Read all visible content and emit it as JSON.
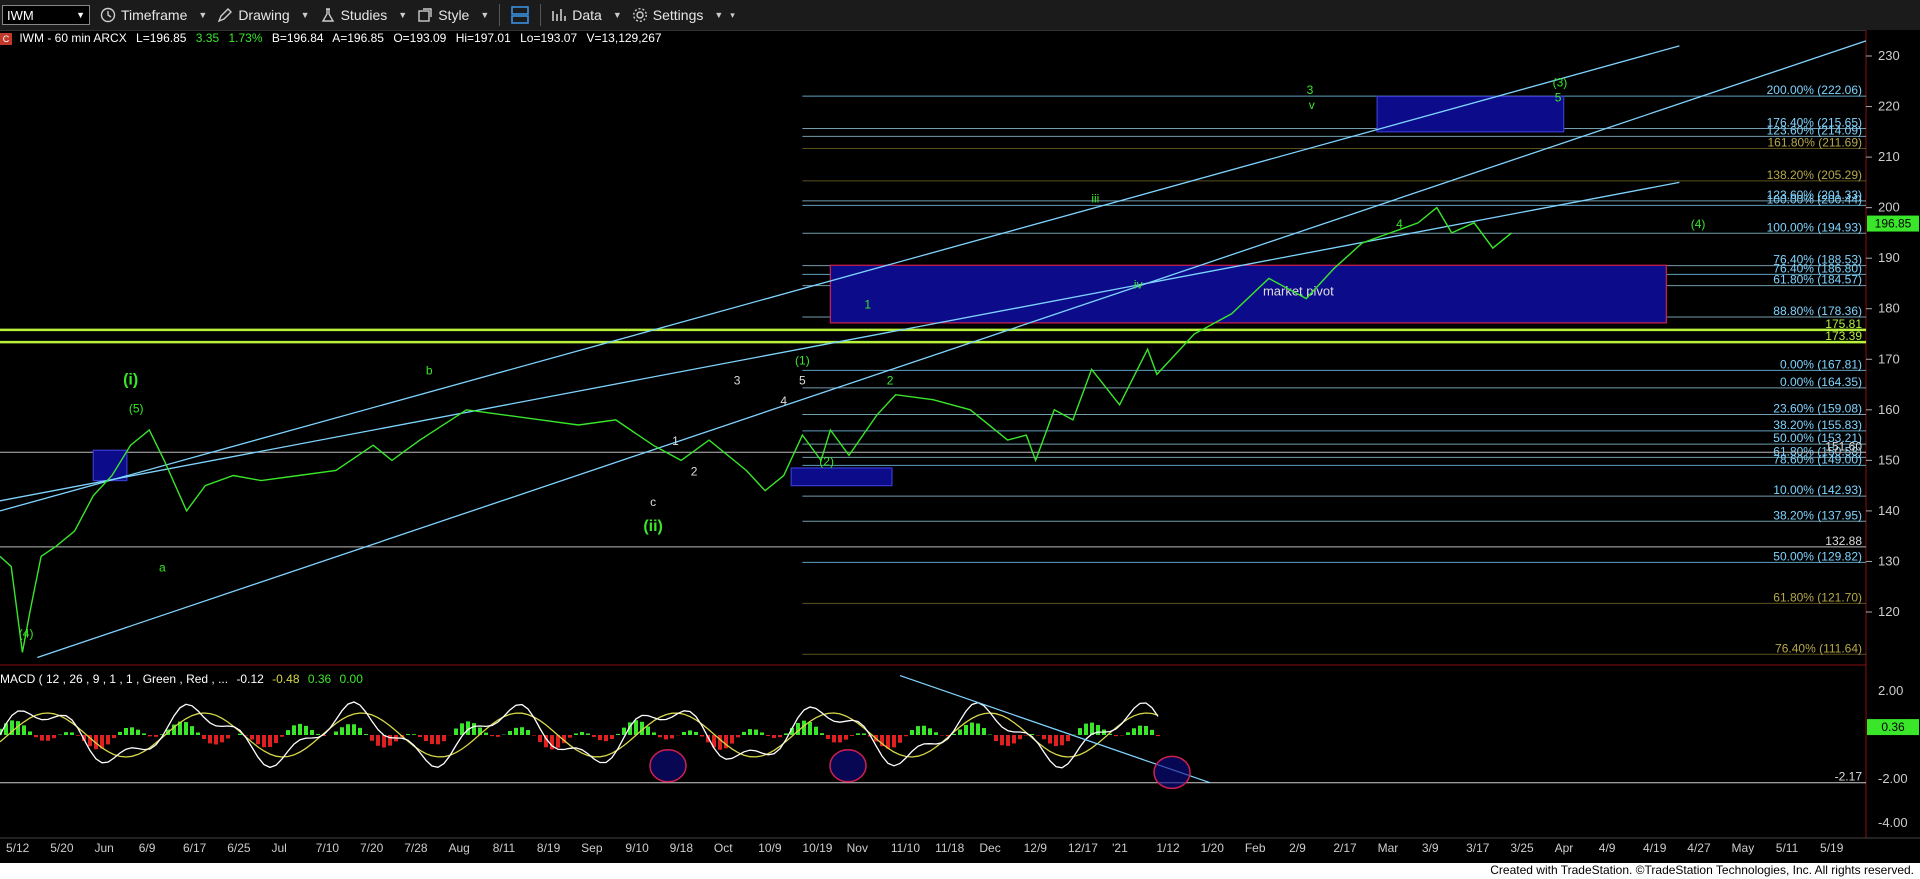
{
  "toolbar": {
    "symbol": "IWM",
    "timeframe": "Timeframe",
    "drawing": "Drawing",
    "studies": "Studies",
    "style": "Style",
    "data": "Data",
    "settings": "Settings"
  },
  "status": {
    "c_badge": "C",
    "symbol_line": "IWM - 60 min  ARCX",
    "last": "L=196.85",
    "change": "3.35",
    "pct": "1.73%",
    "bid": "B=196.84",
    "ask": "A=196.85",
    "open": "O=193.09",
    "high": "Hi=197.01",
    "low": "Lo=193.07",
    "volume": "V=13,129,267"
  },
  "macd_header": {
    "label": "MACD ( 12 , 26 , 9 , 1 , 1 , Green , Red , ...",
    "v1": "-0.12",
    "v2": "-0.48",
    "v3": "0.36",
    "v4": "0.00"
  },
  "footer": "Created with TradeStation. ©TradeStation Technologies, Inc. All rights reserved.",
  "colors": {
    "price": "#39e62a",
    "fib": "#7fd4ff",
    "box": "#0c0c8a",
    "pivot": "#b8f23a",
    "macd_line": "#ffffff",
    "signal_line": "#d7d74a"
  },
  "chart_data": {
    "type": "line",
    "title": "IWM - 60 min",
    "yrange": [
      110,
      234
    ],
    "last_price": "196.85",
    "x_ticks": [
      "5/12",
      "5/20",
      "Jun",
      "6/9",
      "6/17",
      "6/25",
      "Jul",
      "7/10",
      "7/20",
      "7/28",
      "Aug",
      "8/11",
      "8/19",
      "Sep",
      "9/10",
      "9/18",
      "Oct",
      "10/9",
      "10/19",
      "Nov",
      "11/10",
      "11/18",
      "Dec",
      "12/9",
      "12/17",
      "'21",
      "1/12",
      "1/20",
      "Feb",
      "2/9",
      "2/17",
      "Mar",
      "3/9",
      "3/17",
      "3/25",
      "Apr",
      "4/9",
      "4/19",
      "4/27",
      "May",
      "5/11",
      "5/19"
    ],
    "y_ticks": [
      "230",
      "220",
      "210",
      "200",
      "190",
      "180",
      "170",
      "160",
      "150",
      "140",
      "130",
      "120"
    ],
    "price_series": {
      "name": "IWM",
      "x": [
        0,
        0.006,
        0.012,
        0.016,
        0.022,
        0.03,
        0.04,
        0.05,
        0.06,
        0.07,
        0.08,
        0.088,
        0.1,
        0.11,
        0.125,
        0.14,
        0.16,
        0.18,
        0.2,
        0.21,
        0.225,
        0.25,
        0.27,
        0.29,
        0.31,
        0.33,
        0.35,
        0.365,
        0.38,
        0.4,
        0.41,
        0.42,
        0.43,
        0.44,
        0.445,
        0.455,
        0.47,
        0.48,
        0.5,
        0.52,
        0.54,
        0.55,
        0.555,
        0.565,
        0.575,
        0.585,
        0.6,
        0.615,
        0.62,
        0.64,
        0.66,
        0.68,
        0.7,
        0.715,
        0.73,
        0.745,
        0.76,
        0.77,
        0.778,
        0.79,
        0.8,
        0.81
      ],
      "y": [
        131,
        129,
        112,
        120,
        131,
        133,
        136,
        143,
        147,
        153,
        156,
        150,
        140,
        145,
        147,
        146,
        147,
        148,
        153,
        150,
        154,
        160,
        159,
        158,
        157,
        158,
        153,
        150,
        154,
        148,
        144,
        147,
        155,
        150,
        156,
        151,
        159,
        163,
        162,
        160,
        154,
        155,
        150,
        160,
        158,
        168,
        161,
        172,
        167,
        175,
        179,
        186,
        182,
        188,
        193,
        195,
        197,
        200,
        195,
        197,
        192,
        195
      ]
    },
    "fib_levels": [
      {
        "label": "200.00% (222.06)",
        "y": 222.06
      },
      {
        "label": "176.40% (215.65)",
        "y": 215.65
      },
      {
        "label": "123.60% (214.09)",
        "y": 214.09
      },
      {
        "label": "161.80% (211.69)",
        "y": 211.69
      },
      {
        "label": "138.20% (205.29)",
        "y": 205.29
      },
      {
        "label": "123.60% (201.33)",
        "y": 201.33
      },
      {
        "label": "100.00% (200.44)",
        "y": 200.44
      },
      {
        "label": "100.00% (194.93)",
        "y": 194.93
      },
      {
        "label": "76.40% (188.53)",
        "y": 188.53
      },
      {
        "label": "76.40% (186.80)",
        "y": 186.8
      },
      {
        "label": "61.80% (184.57)",
        "y": 184.57
      },
      {
        "label": "88.80% (178.36)",
        "y": 178.36
      },
      {
        "label": "0.00% (167.81)",
        "y": 167.81
      },
      {
        "label": "0.00% (164.35)",
        "y": 164.35
      },
      {
        "label": "23.60% (159.08)",
        "y": 159.08
      },
      {
        "label": "38.20% (155.83)",
        "y": 155.83
      },
      {
        "label": "50.00% (153.21)",
        "y": 153.21
      },
      {
        "label": "61.80% (150.58)",
        "y": 150.58
      },
      {
        "label": "78.60% (149.00)",
        "y": 149.0
      },
      {
        "label": "10.00% (142.93)",
        "y": 142.93
      },
      {
        "label": "38.20% (137.95)",
        "y": 137.95
      },
      {
        "label": "50.00% (129.82)",
        "y": 129.82
      },
      {
        "label": "61.80% (121.70)",
        "y": 121.7
      },
      {
        "label": "76.40% (111.64)",
        "y": 111.64
      }
    ],
    "pivot_levels": [
      "175.81",
      "173.39"
    ],
    "plain_levels": [
      "132.88",
      "151.60"
    ],
    "boxes": [
      {
        "label": "market pivot"
      },
      {
        "label": ""
      },
      {
        "label": ""
      },
      {
        "label": ""
      }
    ],
    "wave_labels": [
      "(3)",
      "5",
      "3",
      "v",
      "iii",
      "4",
      "(4)",
      "iv",
      "1",
      "2",
      "(1)",
      "3",
      "5",
      "4",
      "(2)",
      "1",
      "2",
      "c",
      "(ii)",
      "b",
      "(i)",
      "(5)",
      "(4)",
      "a"
    ],
    "macd": {
      "y_ticks": [
        "2.00",
        "-2.00",
        "-4.00"
      ],
      "last_value": "0.36",
      "min_marker": "-2.17"
    }
  }
}
